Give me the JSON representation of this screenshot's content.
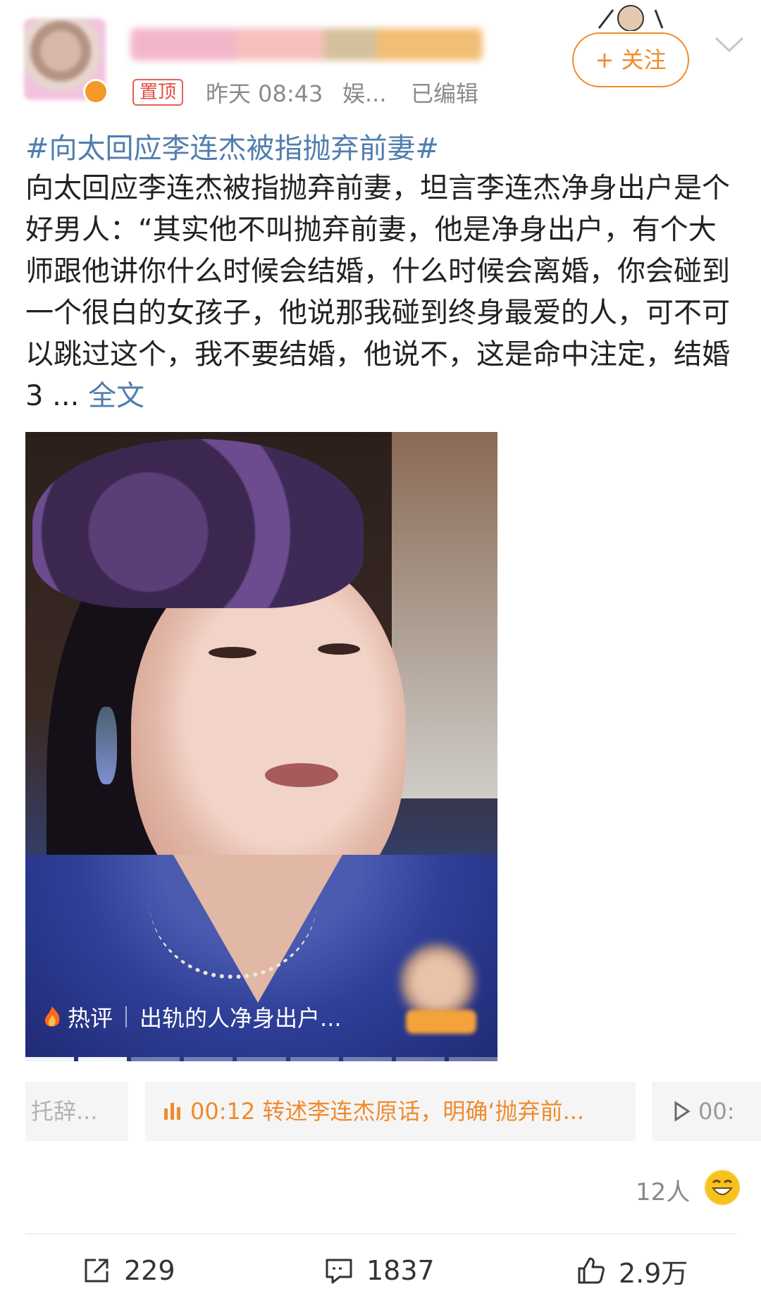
{
  "post": {
    "pin_label": "置顶",
    "time": "昨天 08:43",
    "source": "娱...",
    "edited": "已编辑",
    "follow_label": "+ 关注",
    "topic": "#向太回应李连杰被指抛弃前妻#",
    "body": "向太回应李连杰被指抛弃前妻，坦言李连杰净身出户是个好男人：“其实他不叫抛弃前妻，他是净身出户，有个大师跟他讲你什么时候会结婚，什么时候会离婚，你会碰到一个很白的女孩子，他说那我碰到终身最爱的人，可不可以跳过这个，我不要结婚，他说不，这是命中注定，结婚3 ...",
    "full_text_link": "全文"
  },
  "video": {
    "hot_label": "热评",
    "hot_comment": "出轨的人净身出户...",
    "progress_segments_total": 9,
    "progress_segments_done": 2
  },
  "chapters": [
    {
      "label": "托辞..."
    },
    {
      "label": "00:12 转述李连杰原话，明确‘抛弃前..."
    },
    {
      "label": "00:"
    }
  ],
  "reactions": {
    "count_label": "12人"
  },
  "actions": {
    "share": "229",
    "comment": "1837",
    "like": "2.9万"
  },
  "colors": {
    "accent_orange": "#f08a2c",
    "link_blue": "#507daf",
    "pin_red": "#e34a40"
  }
}
